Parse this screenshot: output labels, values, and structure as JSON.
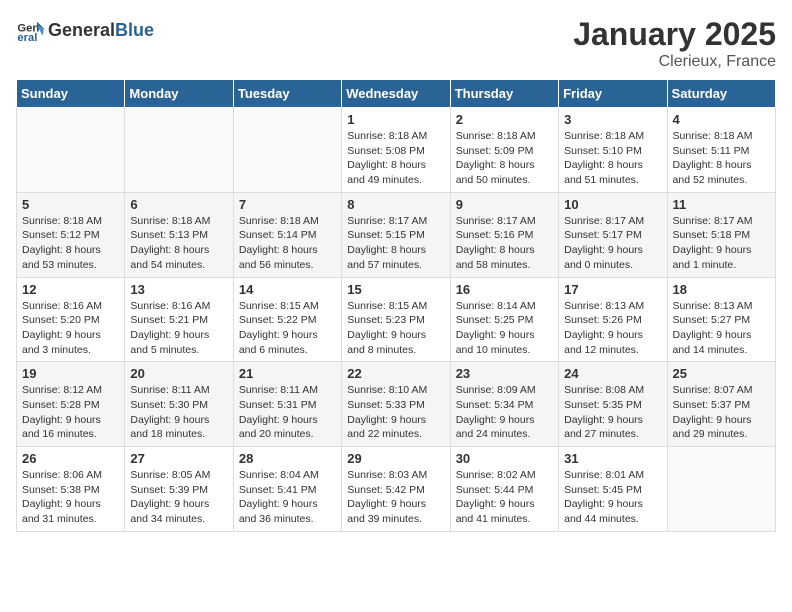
{
  "logo": {
    "general": "General",
    "blue": "Blue"
  },
  "title": {
    "month": "January 2025",
    "location": "Clerieux, France"
  },
  "weekdays": [
    "Sunday",
    "Monday",
    "Tuesday",
    "Wednesday",
    "Thursday",
    "Friday",
    "Saturday"
  ],
  "weeks": [
    [
      {
        "day": "",
        "content": ""
      },
      {
        "day": "",
        "content": ""
      },
      {
        "day": "",
        "content": ""
      },
      {
        "day": "1",
        "content": "Sunrise: 8:18 AM\nSunset: 5:08 PM\nDaylight: 8 hours\nand 49 minutes."
      },
      {
        "day": "2",
        "content": "Sunrise: 8:18 AM\nSunset: 5:09 PM\nDaylight: 8 hours\nand 50 minutes."
      },
      {
        "day": "3",
        "content": "Sunrise: 8:18 AM\nSunset: 5:10 PM\nDaylight: 8 hours\nand 51 minutes."
      },
      {
        "day": "4",
        "content": "Sunrise: 8:18 AM\nSunset: 5:11 PM\nDaylight: 8 hours\nand 52 minutes."
      }
    ],
    [
      {
        "day": "5",
        "content": "Sunrise: 8:18 AM\nSunset: 5:12 PM\nDaylight: 8 hours\nand 53 minutes."
      },
      {
        "day": "6",
        "content": "Sunrise: 8:18 AM\nSunset: 5:13 PM\nDaylight: 8 hours\nand 54 minutes."
      },
      {
        "day": "7",
        "content": "Sunrise: 8:18 AM\nSunset: 5:14 PM\nDaylight: 8 hours\nand 56 minutes."
      },
      {
        "day": "8",
        "content": "Sunrise: 8:17 AM\nSunset: 5:15 PM\nDaylight: 8 hours\nand 57 minutes."
      },
      {
        "day": "9",
        "content": "Sunrise: 8:17 AM\nSunset: 5:16 PM\nDaylight: 8 hours\nand 58 minutes."
      },
      {
        "day": "10",
        "content": "Sunrise: 8:17 AM\nSunset: 5:17 PM\nDaylight: 9 hours\nand 0 minutes."
      },
      {
        "day": "11",
        "content": "Sunrise: 8:17 AM\nSunset: 5:18 PM\nDaylight: 9 hours\nand 1 minute."
      }
    ],
    [
      {
        "day": "12",
        "content": "Sunrise: 8:16 AM\nSunset: 5:20 PM\nDaylight: 9 hours\nand 3 minutes."
      },
      {
        "day": "13",
        "content": "Sunrise: 8:16 AM\nSunset: 5:21 PM\nDaylight: 9 hours\nand 5 minutes."
      },
      {
        "day": "14",
        "content": "Sunrise: 8:15 AM\nSunset: 5:22 PM\nDaylight: 9 hours\nand 6 minutes."
      },
      {
        "day": "15",
        "content": "Sunrise: 8:15 AM\nSunset: 5:23 PM\nDaylight: 9 hours\nand 8 minutes."
      },
      {
        "day": "16",
        "content": "Sunrise: 8:14 AM\nSunset: 5:25 PM\nDaylight: 9 hours\nand 10 minutes."
      },
      {
        "day": "17",
        "content": "Sunrise: 8:13 AM\nSunset: 5:26 PM\nDaylight: 9 hours\nand 12 minutes."
      },
      {
        "day": "18",
        "content": "Sunrise: 8:13 AM\nSunset: 5:27 PM\nDaylight: 9 hours\nand 14 minutes."
      }
    ],
    [
      {
        "day": "19",
        "content": "Sunrise: 8:12 AM\nSunset: 5:28 PM\nDaylight: 9 hours\nand 16 minutes."
      },
      {
        "day": "20",
        "content": "Sunrise: 8:11 AM\nSunset: 5:30 PM\nDaylight: 9 hours\nand 18 minutes."
      },
      {
        "day": "21",
        "content": "Sunrise: 8:11 AM\nSunset: 5:31 PM\nDaylight: 9 hours\nand 20 minutes."
      },
      {
        "day": "22",
        "content": "Sunrise: 8:10 AM\nSunset: 5:33 PM\nDaylight: 9 hours\nand 22 minutes."
      },
      {
        "day": "23",
        "content": "Sunrise: 8:09 AM\nSunset: 5:34 PM\nDaylight: 9 hours\nand 24 minutes."
      },
      {
        "day": "24",
        "content": "Sunrise: 8:08 AM\nSunset: 5:35 PM\nDaylight: 9 hours\nand 27 minutes."
      },
      {
        "day": "25",
        "content": "Sunrise: 8:07 AM\nSunset: 5:37 PM\nDaylight: 9 hours\nand 29 minutes."
      }
    ],
    [
      {
        "day": "26",
        "content": "Sunrise: 8:06 AM\nSunset: 5:38 PM\nDaylight: 9 hours\nand 31 minutes."
      },
      {
        "day": "27",
        "content": "Sunrise: 8:05 AM\nSunset: 5:39 PM\nDaylight: 9 hours\nand 34 minutes."
      },
      {
        "day": "28",
        "content": "Sunrise: 8:04 AM\nSunset: 5:41 PM\nDaylight: 9 hours\nand 36 minutes."
      },
      {
        "day": "29",
        "content": "Sunrise: 8:03 AM\nSunset: 5:42 PM\nDaylight: 9 hours\nand 39 minutes."
      },
      {
        "day": "30",
        "content": "Sunrise: 8:02 AM\nSunset: 5:44 PM\nDaylight: 9 hours\nand 41 minutes."
      },
      {
        "day": "31",
        "content": "Sunrise: 8:01 AM\nSunset: 5:45 PM\nDaylight: 9 hours\nand 44 minutes."
      },
      {
        "day": "",
        "content": ""
      }
    ]
  ]
}
